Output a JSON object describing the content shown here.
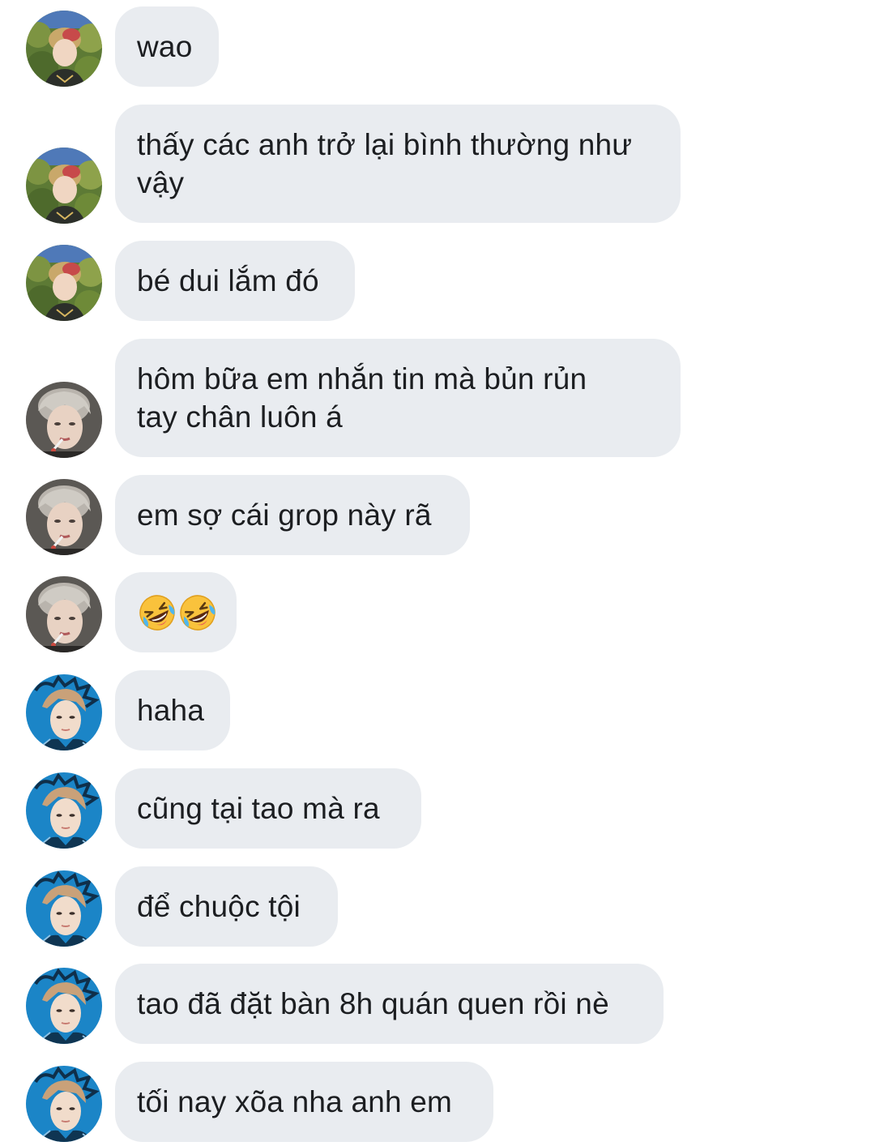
{
  "messages": [
    {
      "sender": "user_a",
      "text": "wao"
    },
    {
      "sender": "user_a",
      "text": "thấy các anh trở lại bình thường như\nvậy"
    },
    {
      "sender": "user_a",
      "text": "bé dui lắm đó"
    },
    {
      "sender": "user_b",
      "text": "hôm bữa em nhắn tin mà bủn rủn\ntay chân luôn á"
    },
    {
      "sender": "user_b",
      "text": "em sợ cái grop này rã"
    },
    {
      "sender": "user_b",
      "text": "🤣🤣",
      "emoji": [
        "rolling-on-floor-laughing",
        "rolling-on-floor-laughing"
      ]
    },
    {
      "sender": "user_c",
      "text": "haha"
    },
    {
      "sender": "user_c",
      "text": "cũng tại tao mà ra"
    },
    {
      "sender": "user_c",
      "text": "để chuộc tội"
    },
    {
      "sender": "user_c",
      "text": "tao đã đặt bàn 8h quán quen rồi nè"
    },
    {
      "sender": "user_c",
      "text": "tối nay xõa nha anh em"
    }
  ],
  "colors": {
    "bubble": "#e9ecf0",
    "text": "#1c1e21",
    "background": "#ffffff",
    "avatar_a": "#6b8a3a",
    "avatar_b": "#7a6e66",
    "avatar_c": "#1a7fc1"
  }
}
